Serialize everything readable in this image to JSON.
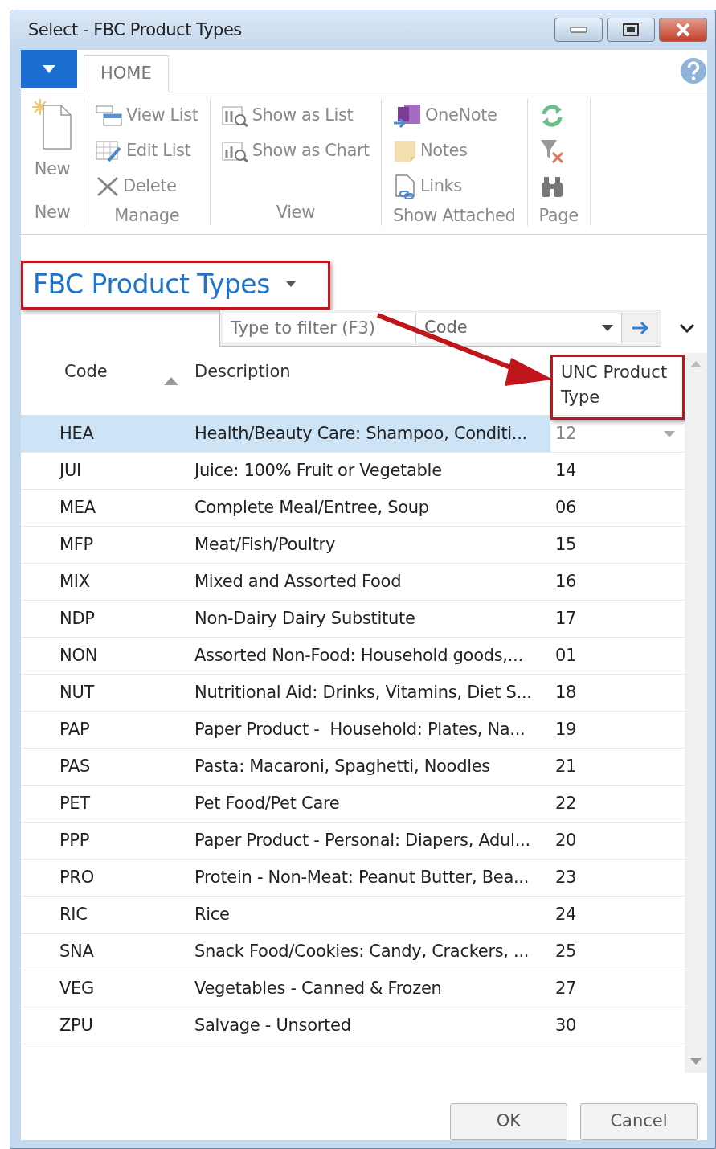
{
  "window": {
    "title": "Select - FBC Product Types"
  },
  "ribbon": {
    "tabs": [
      {
        "label": "HOME",
        "selected": true
      }
    ],
    "groups": [
      {
        "label": "New",
        "items": [
          {
            "label": "New",
            "kind": "new"
          }
        ]
      },
      {
        "label": "Manage",
        "items": [
          {
            "label": "View List",
            "kind": "viewlist"
          },
          {
            "label": "Edit List",
            "kind": "editlist"
          },
          {
            "label": "Delete",
            "kind": "delete"
          }
        ]
      },
      {
        "label": "View",
        "items": [
          {
            "label": "Show as List",
            "kind": "showlist"
          },
          {
            "label": "Show as Chart",
            "kind": "showchart"
          }
        ]
      },
      {
        "label": "Show Attached",
        "items": [
          {
            "label": "OneNote",
            "kind": "onenote"
          },
          {
            "label": "Notes",
            "kind": "notes"
          },
          {
            "label": "Links",
            "kind": "links"
          }
        ]
      },
      {
        "label": "Page",
        "items": [
          {
            "kind": "refresh"
          },
          {
            "kind": "clearfilter"
          },
          {
            "kind": "find"
          }
        ]
      }
    ]
  },
  "page_title": {
    "text": "FBC Product Types",
    "highlighted": true
  },
  "filter": {
    "placeholder": "Type to filter (F3)",
    "field": "Code"
  },
  "annotation_arrow": true,
  "table": {
    "columns": [
      {
        "label": "Code",
        "sorted": true,
        "highlighted": false
      },
      {
        "label": "Description",
        "sorted": false,
        "highlighted": false
      },
      {
        "label": "UNC Product Type",
        "sorted": false,
        "highlighted": true
      }
    ],
    "rows": [
      {
        "code": "HEA",
        "description": "Health/Beauty Care: Shampoo, Conditi...",
        "unc": "12",
        "selected": true
      },
      {
        "code": "JUI",
        "description": "Juice: 100% Fruit or Vegetable",
        "unc": "14",
        "selected": false
      },
      {
        "code": "MEA",
        "description": "Complete Meal/Entree, Soup",
        "unc": "06",
        "selected": false
      },
      {
        "code": "MFP",
        "description": "Meat/Fish/Poultry",
        "unc": "15",
        "selected": false
      },
      {
        "code": "MIX",
        "description": "Mixed and Assorted Food",
        "unc": "16",
        "selected": false
      },
      {
        "code": "NDP",
        "description": "Non-Dairy Dairy Substitute",
        "unc": "17",
        "selected": false
      },
      {
        "code": "NON",
        "description": "Assorted Non-Food: Household goods,...",
        "unc": "01",
        "selected": false
      },
      {
        "code": "NUT",
        "description": "Nutritional Aid: Drinks, Vitamins, Diet S...",
        "unc": "18",
        "selected": false
      },
      {
        "code": "PAP",
        "description": "Paper Product -  Household: Plates, Na...",
        "unc": "19",
        "selected": false
      },
      {
        "code": "PAS",
        "description": "Pasta: Macaroni, Spaghetti, Noodles",
        "unc": "21",
        "selected": false
      },
      {
        "code": "PET",
        "description": "Pet Food/Pet Care",
        "unc": "22",
        "selected": false
      },
      {
        "code": "PPP",
        "description": "Paper Product - Personal: Diapers, Adul...",
        "unc": "20",
        "selected": false
      },
      {
        "code": "PRO",
        "description": "Protein - Non-Meat: Peanut Butter, Bea...",
        "unc": "23",
        "selected": false
      },
      {
        "code": "RIC",
        "description": "Rice",
        "unc": "24",
        "selected": false
      },
      {
        "code": "SNA",
        "description": "Snack Food/Cookies: Candy, Crackers, ...",
        "unc": "25",
        "selected": false
      },
      {
        "code": "VEG",
        "description": "Vegetables - Canned & Frozen",
        "unc": "27",
        "selected": false
      },
      {
        "code": "ZPU",
        "description": "Salvage - Unsorted",
        "unc": "30",
        "selected": false
      }
    ]
  },
  "buttons": [
    {
      "label": "OK"
    },
    {
      "label": "Cancel"
    }
  ]
}
